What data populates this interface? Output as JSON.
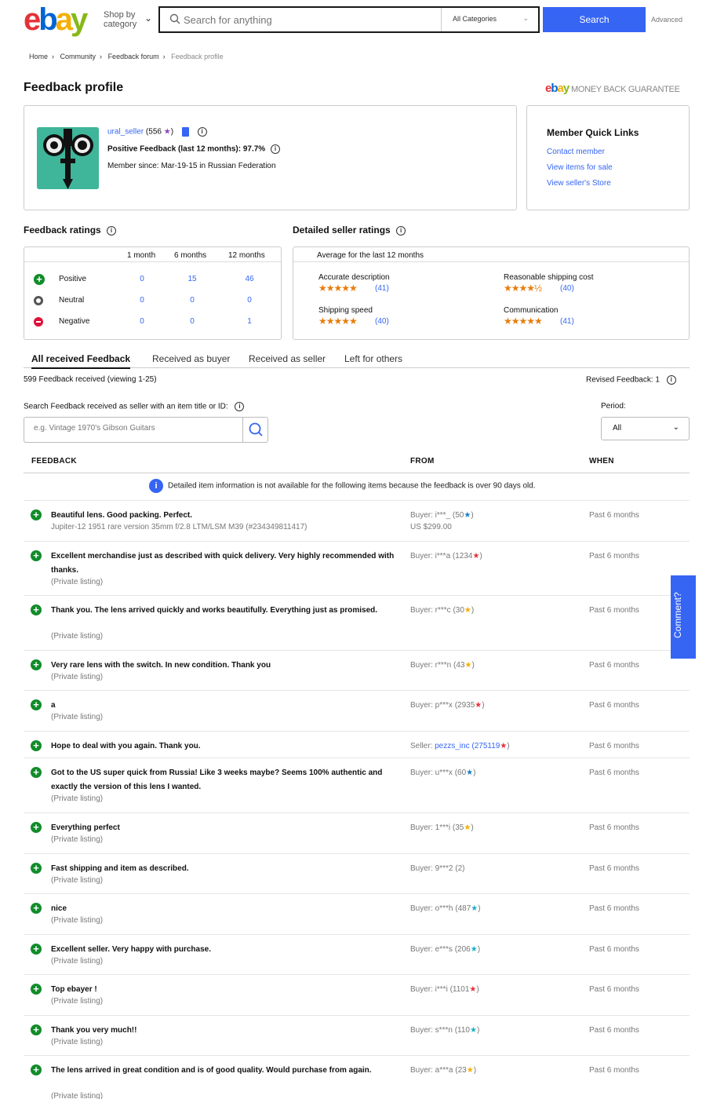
{
  "header": {
    "shop_by": "Shop by category",
    "search_placeholder": "Search for anything",
    "category": "All Categories",
    "search_button": "Search",
    "advanced": "Advanced"
  },
  "breadcrumb": [
    "Home",
    "Community",
    "Feedback forum",
    "Feedback profile"
  ],
  "page_title": "Feedback profile",
  "mbg": "MONEY BACK GUARANTEE",
  "profile": {
    "username": "ural_seller",
    "score": "(556",
    "score_close": ")",
    "positive": "Positive Feedback (last 12 months): 97.7%",
    "since": "Member since: Mar-19-15 in Russian Federation"
  },
  "quick_links": {
    "title": "Member Quick Links",
    "links": [
      "Contact member",
      "View items for sale",
      "View seller's Store"
    ]
  },
  "feedback_ratings": {
    "title": "Feedback ratings",
    "headers": [
      "1 month",
      "6 months",
      "12 months"
    ],
    "rows": [
      {
        "label": "Positive",
        "values": [
          "0",
          "15",
          "46"
        ]
      },
      {
        "label": "Neutral",
        "values": [
          "0",
          "0",
          "0"
        ]
      },
      {
        "label": "Negative",
        "values": [
          "0",
          "0",
          "1"
        ]
      }
    ]
  },
  "dsr": {
    "title": "Detailed seller ratings",
    "subtitle": "Average for the last 12 months",
    "items": [
      {
        "label": "Accurate description",
        "stars": "★★★★★",
        "count": "(41)",
        "rating": 5
      },
      {
        "label": "Reasonable shipping cost",
        "stars": "★★★★½",
        "count": "(40)",
        "rating": 4.5
      },
      {
        "label": "Shipping speed",
        "stars": "★★★★★",
        "count": "(40)",
        "rating": 5
      },
      {
        "label": "Communication",
        "stars": "★★★★★",
        "count": "(41)",
        "rating": 5
      }
    ]
  },
  "tabs": [
    "All received Feedback",
    "Received as buyer",
    "Received as seller",
    "Left for others"
  ],
  "count_text": "599 Feedback received (viewing 1-25)",
  "revised": "Revised Feedback: 1",
  "search_label": "Search Feedback received as seller with an item title or ID:",
  "search_placeholder": "e.g. Vintage 1970's Gibson Guitars",
  "period_label": "Period:",
  "period_value": "All",
  "table_headers": [
    "FEEDBACK",
    "FROM",
    "WHEN"
  ],
  "notice": "Detailed item information is not available for the following items because the feedback is over 90 days old.",
  "rows": [
    {
      "comment": "Beautiful lens. Good packing. Perfect.",
      "sub": "Jupiter-12 1951 rare version 35mm f/2.8 LTM/LSM M39 (#234349811417)",
      "from": "Buyer: i***_ (50",
      "star_color": "#1c7fc4",
      "price": "US $299.00",
      "when": "Past 6 months"
    },
    {
      "comment": "Excellent merchandise just as described with quick delivery. Very highly recommended with thanks.",
      "sub": "(Private listing)",
      "from": "Buyer: i***a (1234",
      "star_color": "#e53238",
      "when": "Past 6 months"
    },
    {
      "comment": "Thank you. The lens arrived quickly and works beautifully. Everything just as promised.",
      "sub": "(Private listing)",
      "from": "Buyer: r***c (30",
      "star_color": "#f5af02",
      "when": "Past 6 months"
    },
    {
      "comment": "Very rare lens with the switch. In new condition. Thank you",
      "sub": "(Private listing)",
      "from": "Buyer: r***n (43",
      "star_color": "#f5af02",
      "when": "Past 6 months"
    },
    {
      "comment": "a",
      "sub": "(Private listing)",
      "from": "Buyer: p***x (2935",
      "star_color": "#e53238",
      "when": "Past 6 months"
    },
    {
      "comment": "Hope to deal with you again. Thank you.",
      "sub": "",
      "from": "Seller: ",
      "seller_link": "pezzs_inc (275119",
      "star_color": "#e53238",
      "when": "Past 6 months"
    },
    {
      "comment": "Got to the US super quick from Russia! Like 3 weeks maybe? Seems 100% authentic and exactly the version of this lens I wanted.",
      "sub": "(Private listing)",
      "from": "Buyer: u***x (60",
      "star_color": "#1c7fc4",
      "when": "Past 6 months"
    },
    {
      "comment": "Everything perfect",
      "sub": "(Private listing)",
      "from": "Buyer: 1***i (35",
      "star_color": "#f5af02",
      "when": "Past 6 months"
    },
    {
      "comment": "Fast shipping and item as described.",
      "sub": "(Private listing)",
      "from": "Buyer: 9***2 (2)",
      "star_color": "",
      "when": "Past 6 months"
    },
    {
      "comment": "nice",
      "sub": "(Private listing)",
      "from": "Buyer: o***h (487",
      "star_color": "#1ab0c4",
      "when": "Past 6 months"
    },
    {
      "comment": "Excellent seller. Very happy with purchase.",
      "sub": "(Private listing)",
      "from": "Buyer: e***s (206",
      "star_color": "#1ab0c4",
      "when": "Past 6 months"
    },
    {
      "comment": "Top ebayer !",
      "sub": "(Private listing)",
      "from": "Buyer: i***i (1101",
      "star_color": "#e53238",
      "when": "Past 6 months"
    },
    {
      "comment": "Thank you very much!!",
      "sub": "(Private listing)",
      "from": "Buyer: s***n (110",
      "star_color": "#1ab0c4",
      "when": "Past 6 months"
    },
    {
      "comment": "The lens arrived in great condition and is of good quality. Would purchase from again.",
      "sub": "(Private listing)",
      "from": "Buyer: a***a (23",
      "star_color": "#f5af02",
      "when": "Past 6 months"
    }
  ],
  "comment_tab": "Comment?"
}
